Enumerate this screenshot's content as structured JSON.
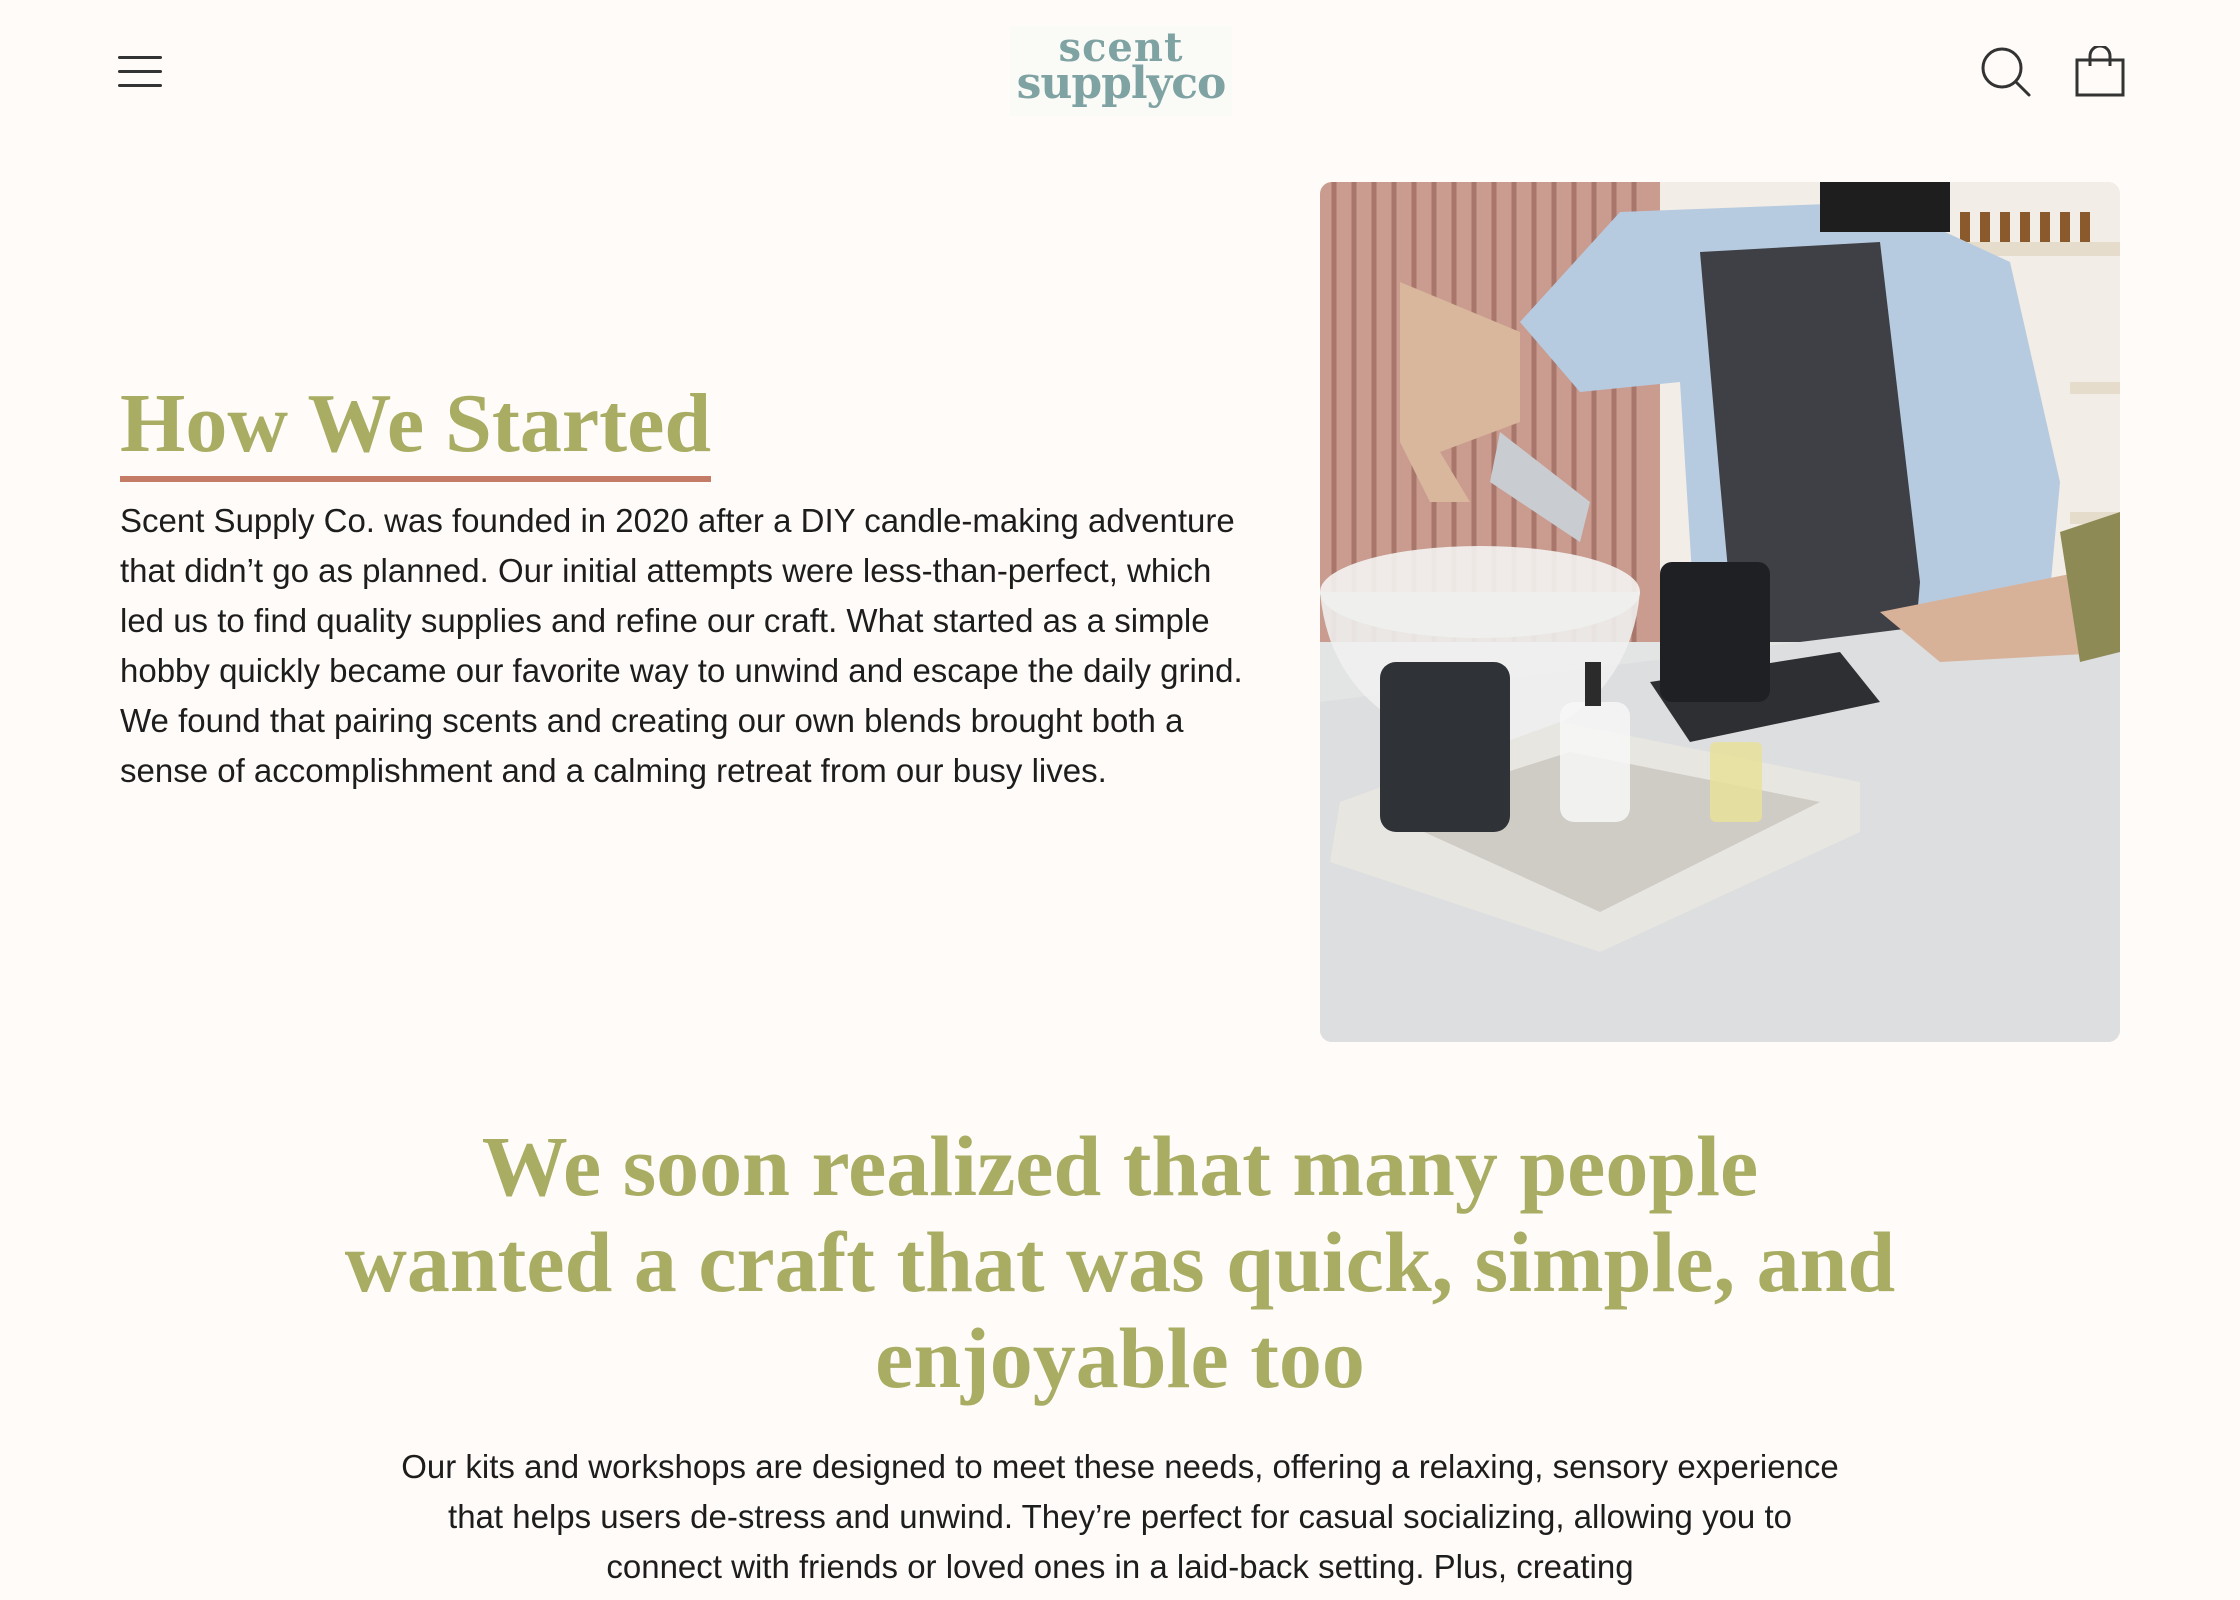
{
  "header": {
    "menu_icon": "hamburger-menu-icon",
    "logo_line1": "scent",
    "logo_line2": "supplyco",
    "search_icon": "search-icon",
    "cart_icon": "shopping-bag-icon"
  },
  "story": {
    "title": "How We Started",
    "body": "Scent Supply Co. was founded in 2020 after a DIY candle-making adventure that didn’t go as planned. Our initial attempts were less-than-perfect, which led us to find quality supplies and refine our craft. What started as a simple hobby quickly became our favorite way to unwind and escape the daily grind. We found that pairing scents and creating our own blends brought both a sense of accomplishment and a calming retreat from our busy lives."
  },
  "mission": {
    "title": "We soon realized that many people wanted a craft that was quick, simple, and enjoyable too",
    "body": "Our kits and workshops are designed to meet these needs, offering a relaxing, sensory experience that helps users de-stress and unwind. They’re perfect for casual socializing, allowing you to connect with friends or loved ones in a laid-back setting. Plus, creating"
  },
  "colors": {
    "background": "#fffbf8",
    "heading": "#a9ad63",
    "underline": "#c47c66",
    "logo": "#7fa3a3"
  }
}
